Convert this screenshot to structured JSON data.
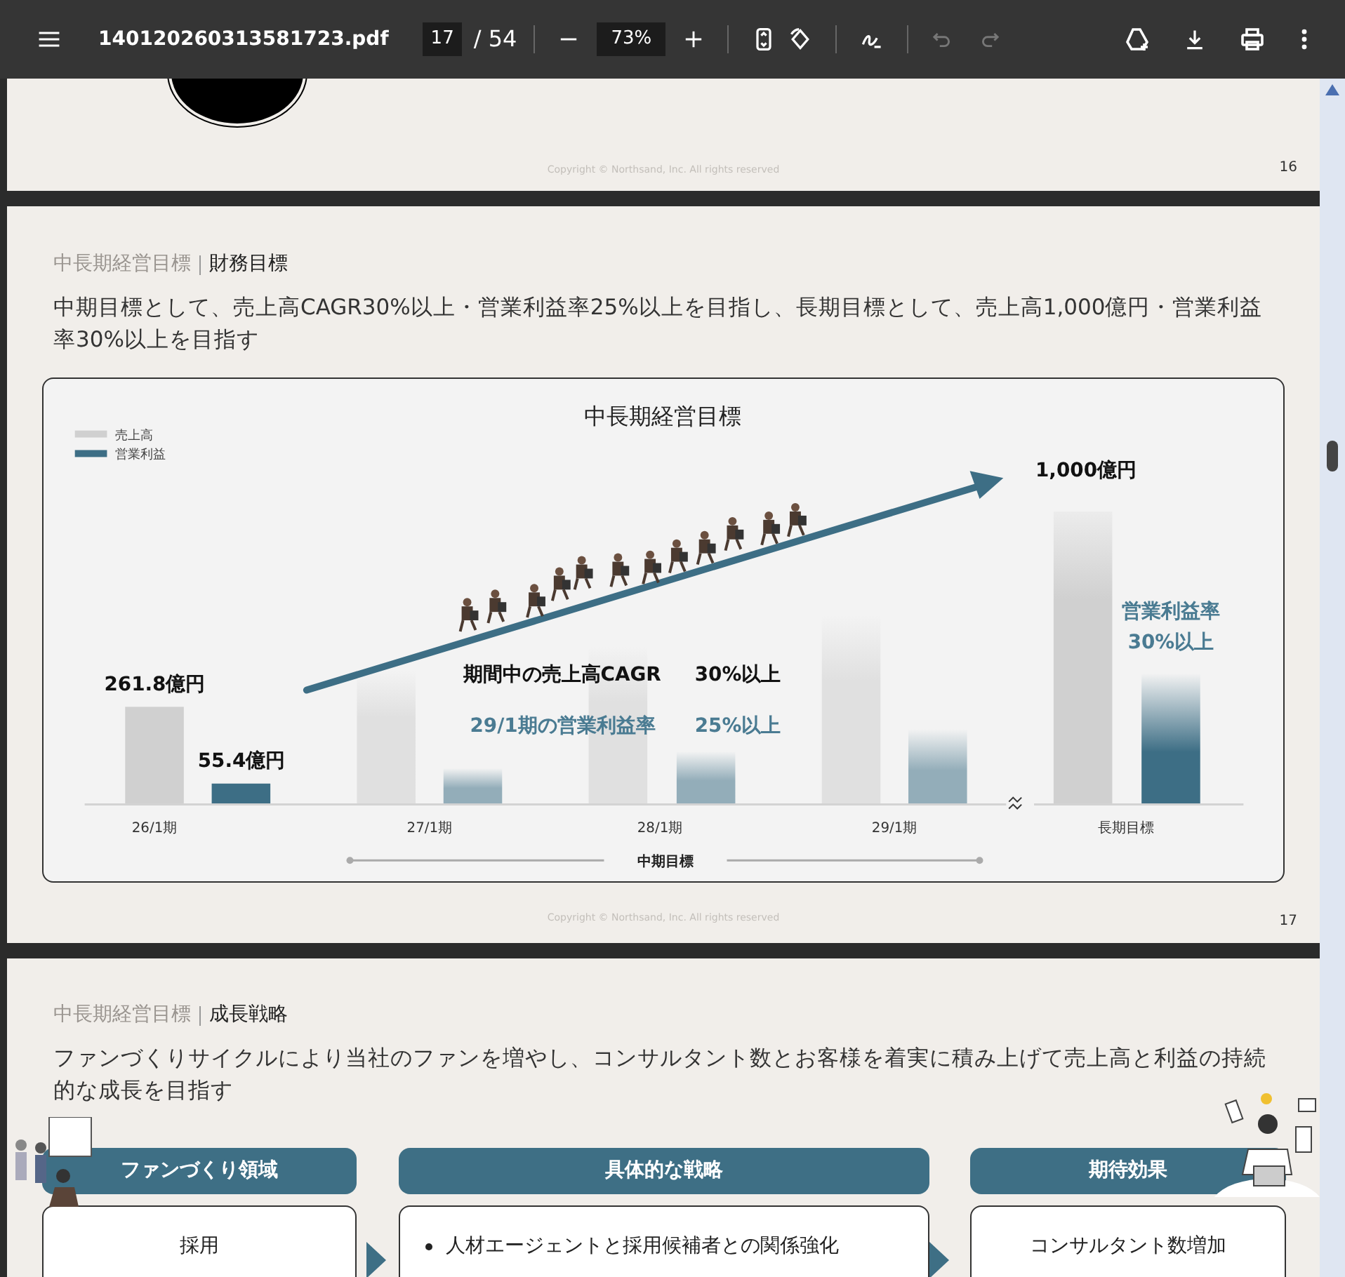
{
  "toolbar": {
    "file_name": "140120260313581723.pdf",
    "page_current": "17",
    "page_total": "/ 54",
    "zoom": "73%",
    "history_buttons": [
      {
        "kind": "undo",
        "disabled": true
      },
      {
        "kind": "redo",
        "disabled": true
      }
    ]
  },
  "pages": [
    {
      "kind": "tail",
      "copyright": "Copyright © Northsand, Inc. All rights reserved",
      "page_number": "16"
    },
    {
      "kind": "chart_slide",
      "breadcrumb": "中長期経営目標",
      "section": "財務目標",
      "lead": "中期目標として、売上高CAGR30%以上・営業利益率25%以上を目指し、長期目標として、売上高1,000億円・営業利益率30%以上を目指す",
      "chart_panel": {
        "title": "中長期経営目標",
        "legend": [
          {
            "label": "売上高",
            "color": "#d0d0d0"
          },
          {
            "label": "営業利益",
            "color": "#3d6e85"
          }
        ],
        "categories": [
          "26/1期",
          "27/1期",
          "28/1期",
          "29/1期",
          "長期目標"
        ],
        "value_labels": [
          "261.8億円",
          "55.4億円",
          "1,000億円"
        ],
        "callout": [
          "営業利益率",
          "30%以上"
        ],
        "notes": [
          {
            "label": "期間中の売上高CAGR",
            "value": "30%以上",
            "kind": "dark"
          },
          {
            "label": "29/1期の営業利益率",
            "value": "25%以上",
            "kind": "accent"
          }
        ],
        "bracket": "中期目標"
      },
      "copyright": "Copyright © Northsand, Inc. All rights reserved",
      "page_number": "17"
    },
    {
      "kind": "strategy_slide",
      "breadcrumb": "中長期経営目標",
      "section": "成長戦略",
      "lead": "ファンづくりサイクルにより当社のファンを増やし、コンサルタント数とお客様を着実に積み上げて売上高と利益の持続的な成長を目指す",
      "columns": [
        {
          "header": "ファンづくり領域",
          "kind": "text",
          "lines": [
            "採用"
          ]
        },
        {
          "header": "具体的な戦略",
          "kind": "bullets",
          "lines": [
            "人材エージェントと採用候補者との関係強化"
          ]
        },
        {
          "header": "期待効果",
          "kind": "text",
          "lines": [
            "コンサルタント数増加"
          ]
        }
      ]
    }
  ]
}
